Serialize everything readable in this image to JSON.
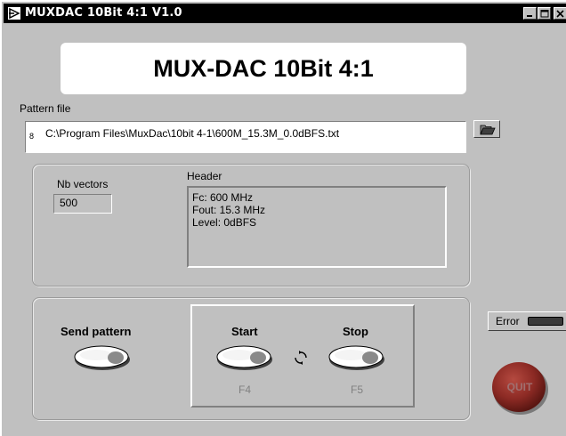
{
  "window": {
    "title": "MUXDAC 10Bit 4:1 V1.0"
  },
  "banner": {
    "title": "MUX-DAC 10Bit 4:1"
  },
  "pattern_file": {
    "label": "Pattern file",
    "path": "C:\\Program Files\\MuxDac\\10bit 4-1\\600M_15.3M_0.0dBFS.txt",
    "marker": "8"
  },
  "vectors": {
    "label": "Nb vectors",
    "value": "500"
  },
  "header": {
    "label": "Header",
    "lines": [
      "Fc: 600 MHz",
      "Fout: 15.3 MHz",
      "Level: 0dBFS"
    ]
  },
  "controls": {
    "send_label": "Send pattern",
    "start_label": "Start",
    "stop_label": "Stop",
    "start_key": "F4",
    "stop_key": "F5"
  },
  "error": {
    "label": "Error"
  },
  "quit": {
    "label": "QUIT"
  },
  "icons": {
    "app": "labview-vi-icon",
    "browse": "open-folder-icon",
    "cycle": "cycle-arrows-icon"
  },
  "colors": {
    "titlebar": "#000000",
    "panel": "#c0c0c0",
    "quit_red": "#8c2a24",
    "error_led": "#3a3a3a"
  }
}
